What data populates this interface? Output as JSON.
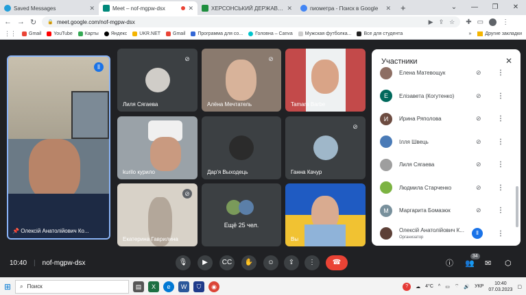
{
  "tabs": [
    {
      "title": "Saved Messages",
      "color": "#229ed9",
      "active": false
    },
    {
      "title": "Meet – nof-mgpw-dsx",
      "color": "#00897b",
      "active": true
    },
    {
      "title": "ХЕРСОНСЬКИЙ ДЕРЖАВНИЙ А",
      "color": "#1e8e3e",
      "active": false
    },
    {
      "title": "пиометра - Поиск в Google",
      "color": "#4285f4",
      "active": false
    }
  ],
  "new_tab": "+",
  "url": "meet.google.com/nof-mgpw-dsx",
  "bookmarks": [
    {
      "label": "Gmail",
      "color": "#ea4335"
    },
    {
      "label": "YouTube",
      "color": "#ff0000"
    },
    {
      "label": "Карты",
      "color": "#34a853"
    },
    {
      "label": "Яндекс",
      "color": "#000000"
    },
    {
      "label": "UKR.NET",
      "color": "#f4b400"
    },
    {
      "label": "Gmail",
      "color": "#ea4335"
    },
    {
      "label": "Программа для со...",
      "color": "#3367d6"
    },
    {
      "label": "Головна – Canva",
      "color": "#00c4cc"
    },
    {
      "label": "Мужская футболка...",
      "color": "#ccc"
    },
    {
      "label": "Все для студента",
      "color": "#222"
    }
  ],
  "bookmarks_more": "»",
  "other_bookmarks": "Другие закладки",
  "tiles": [
    {
      "name": "Олексій Анатолійович Ко...",
      "pin": "pin-icon",
      "speaking": true
    },
    {
      "name": "Лиля Сягаева",
      "muted": true
    },
    {
      "name": "Алёна Мечтатель",
      "muted": true
    },
    {
      "name": "Tamara Barbe",
      "muted": false
    },
    {
      "name": "kurilo курило",
      "muted": false
    },
    {
      "name": "Дар'я Выходець",
      "muted": false
    },
    {
      "name": "Ганна Качур",
      "muted": true
    },
    {
      "name": "Екатерина Гаврилина",
      "muted": true
    },
    {
      "name": "Ещё 25 чел.",
      "muted": false
    },
    {
      "name": "Вы",
      "muted": false
    }
  ],
  "meeting": {
    "time": "10:40",
    "code": "nof-mgpw-dsx"
  },
  "participants_count": "34",
  "panel": {
    "title": "Участники",
    "people": [
      {
        "name": "Елена Матевощук",
        "initial": "",
        "color": "#8d6e63"
      },
      {
        "name": "Елізавета (Когутенко)",
        "initial": "Е",
        "color": "#00695c"
      },
      {
        "name": "Ирина Ряполова",
        "initial": "И",
        "color": "#6d4c41"
      },
      {
        "name": "Ілля Швець",
        "initial": "",
        "color": "#4a7bb7"
      },
      {
        "name": "Лиля Сягаева",
        "initial": "",
        "color": "#9e9e9e"
      },
      {
        "name": "Людмила Старченко",
        "initial": "",
        "color": "#7cb342"
      },
      {
        "name": "Маргарита Бомазюк",
        "initial": "М",
        "color": "#78909c"
      },
      {
        "name": "Олексій Анатолійович К...",
        "sub": "Организатор",
        "initial": "",
        "color": "#5d4037"
      }
    ]
  },
  "taskbar": {
    "search": "Поиск",
    "weather": "4°C",
    "lang": "УКР",
    "time": "10:40",
    "date": "07.03.2023"
  }
}
